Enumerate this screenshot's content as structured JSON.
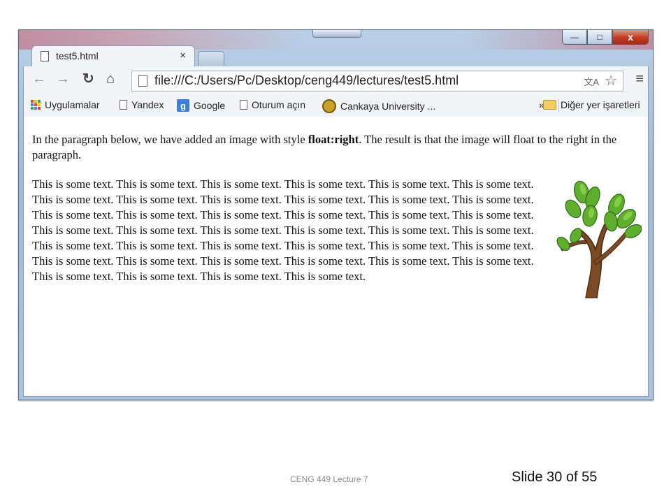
{
  "browser": {
    "tab_title": "test5.html",
    "tab_close": "×",
    "url": "file:///C:/Users/Pc/Desktop/ceng449/lectures/test5.html",
    "window_controls": {
      "minimize": "—",
      "maximize": "□",
      "close": "x"
    },
    "nav": {
      "back": "←",
      "forward": "→",
      "reload": "↻",
      "home": "⌂",
      "menu": "≡",
      "star": "☆",
      "translate": "文A"
    }
  },
  "bookmarks": {
    "items": [
      {
        "label": "Uygulamalar",
        "icon": "apps-grid-icon"
      },
      {
        "label": "Yandex",
        "icon": "page-icon"
      },
      {
        "label": "Google",
        "icon": "google-icon"
      },
      {
        "label": "Oturum açın",
        "icon": "page-icon"
      },
      {
        "label": "Cankaya University ...",
        "icon": "university-icon"
      }
    ],
    "overflow": "»",
    "other": {
      "label": "Diğer yer işaretleri",
      "icon": "folder-icon"
    },
    "google_letter": "g"
  },
  "page": {
    "intro_before": "In the paragraph below, we have added an image with style ",
    "intro_bold": "float:right",
    "intro_after": ". The result is that the image will float to the right in the paragraph.",
    "paragraph": "This is some text. This is some text. This is some text. This is some text. This is some text. This is some text. This is some text. This is some text. This is some text. This is some text. This is some text. This is some text. This is some text. This is some text. This is some text. This is some text. This is some text. This is some text. This is some text. This is some text. This is some text. This is some text. This is some text. This is some text. This is some text. This is some text. This is some text. This is some text. This is some text. This is some text. This is some text. This is some text. This is some text. This is some text. This is some text. This is some text. This is some text. This is some text. This is some text. This is some text."
  },
  "slide": {
    "footer_center": "CENG 449 Lecture 7",
    "footer_right": "Slide 30 of 55"
  }
}
